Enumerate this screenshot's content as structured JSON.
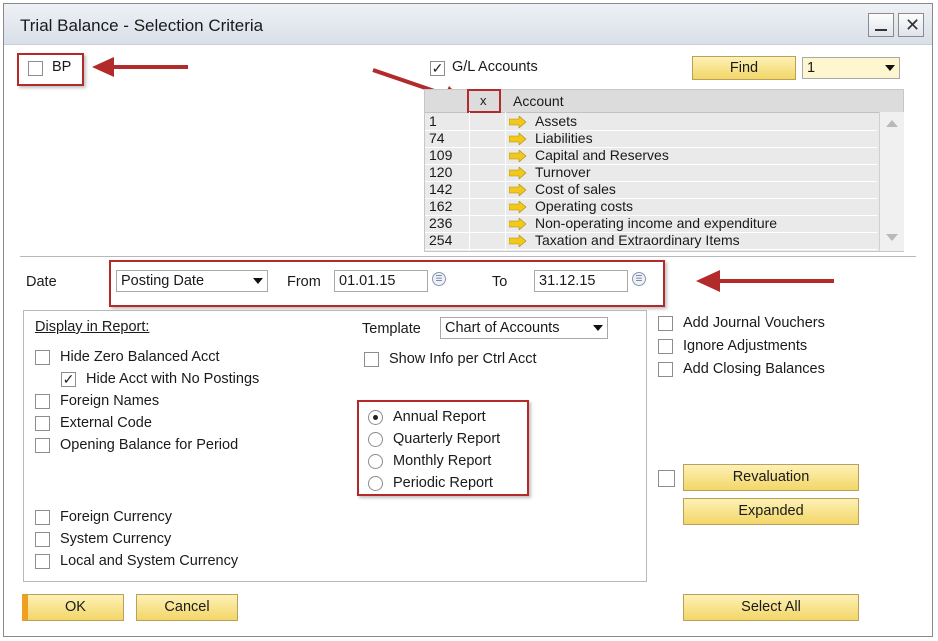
{
  "window": {
    "title": "Trial Balance - Selection Criteria"
  },
  "bp": {
    "label": "BP",
    "checked": false
  },
  "gl_accounts": {
    "label": "G/L Accounts",
    "checked": true
  },
  "find": {
    "label": "Find",
    "value": "1"
  },
  "table": {
    "col_x": "x",
    "col_account": "Account",
    "rows": [
      {
        "num": "1",
        "name": "Assets"
      },
      {
        "num": "74",
        "name": "Liabilities"
      },
      {
        "num": "109",
        "name": "Capital and Reserves"
      },
      {
        "num": "120",
        "name": "Turnover"
      },
      {
        "num": "142",
        "name": "Cost of sales"
      },
      {
        "num": "162",
        "name": "Operating costs"
      },
      {
        "num": "236",
        "name": "Non-operating income and expenditure"
      },
      {
        "num": "254",
        "name": "Taxation and Extraordinary Items"
      }
    ]
  },
  "date": {
    "label": "Date",
    "type": "Posting Date",
    "from_label": "From",
    "from_value": "01.01.15",
    "to_label": "To",
    "to_value": "31.12.15"
  },
  "display": {
    "heading": "Display in Report:",
    "options": [
      {
        "label": "Hide Zero Balanced Acct",
        "checked": false
      },
      {
        "label": "Hide Acct with No Postings",
        "checked": true
      },
      {
        "label": "Foreign Names",
        "checked": false
      },
      {
        "label": "External Code",
        "checked": false
      },
      {
        "label": "Opening Balance for Period",
        "checked": false
      }
    ],
    "currency": [
      {
        "label": "Foreign Currency",
        "checked": false
      },
      {
        "label": "System Currency",
        "checked": false
      },
      {
        "label": "Local and System Currency",
        "checked": false
      }
    ]
  },
  "template": {
    "label": "Template",
    "value": "Chart of Accounts"
  },
  "show_info": {
    "label": "Show Info per Ctrl Acct",
    "checked": false
  },
  "report_type": {
    "options": [
      "Annual Report",
      "Quarterly Report",
      "Monthly Report",
      "Periodic Report"
    ],
    "selected": "Annual Report"
  },
  "right_options": [
    {
      "label": "Add Journal Vouchers",
      "checked": false
    },
    {
      "label": "Ignore Adjustments",
      "checked": false
    },
    {
      "label": "Add Closing Balances",
      "checked": false
    }
  ],
  "buttons": {
    "revaluation": "Revaluation",
    "expanded": "Expanded",
    "ok": "OK",
    "cancel": "Cancel",
    "select_all": "Select All"
  },
  "colors": {
    "accent_red": "#b22a2a",
    "button_yellow": "#f3d668",
    "arrow_yellow": "#f2c81b"
  },
  "icons": {
    "row_arrow": "yellow-right-arrow-icon",
    "calendar": "calendar-icon",
    "minimize": "minimize-icon",
    "close": "close-icon"
  }
}
